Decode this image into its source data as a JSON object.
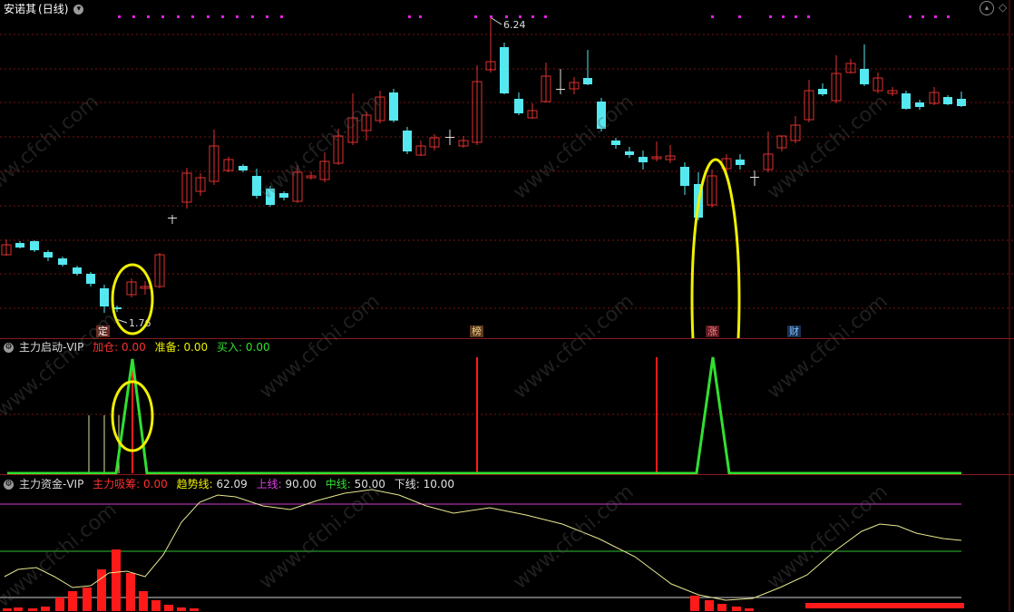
{
  "window": {
    "title": "安诺其",
    "period": "(日线)"
  },
  "main_chart": {
    "high_label": "6.24",
    "low_label": "1.76",
    "markers": [
      "定",
      "榜",
      "涨",
      "财"
    ],
    "candle_colors": {
      "up": "#e03030",
      "down": "#55e8f0"
    }
  },
  "indicator1": {
    "name": "主力启动-VIP",
    "fields": [
      {
        "label": "加仓:",
        "value": "0.00",
        "color": "#ff3030"
      },
      {
        "label": "准备:",
        "value": "0.00",
        "color": "#f0f000"
      },
      {
        "label": "买入:",
        "value": "0.00",
        "color": "#30e030"
      }
    ]
  },
  "indicator2": {
    "name": "主力资金-VIP",
    "fields": [
      {
        "label": "主力吸筹:",
        "value": "0.00",
        "color": "#ff3030"
      },
      {
        "label": "趋势线:",
        "value": "62.09",
        "color": "#f0f000"
      },
      {
        "label": "上线:",
        "value": "90.00",
        "color": "#e040e0"
      },
      {
        "label": "中线:",
        "value": "50.00",
        "color": "#30e030"
      },
      {
        "label": "下线:",
        "value": "10.00",
        "color": "#e0e0e0"
      }
    ]
  },
  "watermark": "www.cfchi.com",
  "icons": {
    "collapse": "chevron-down-icon",
    "scroll_up": "chevron-up-icon",
    "diamond": "diamond-icon"
  }
}
